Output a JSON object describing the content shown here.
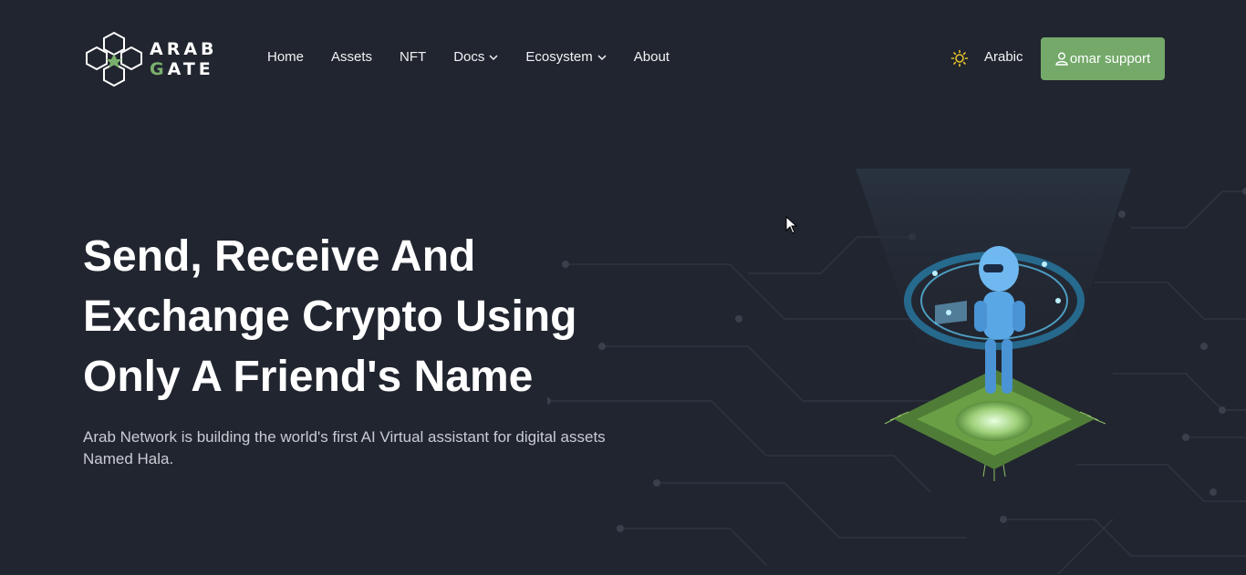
{
  "brand": {
    "line1": "ARAB",
    "line2_first": "G",
    "line2_rest": "ATE",
    "accent_color": "#7ab06d",
    "icon": "hexagon-cluster-logo-icon"
  },
  "nav": {
    "items": [
      {
        "label": "Home",
        "has_dropdown": false
      },
      {
        "label": "Assets",
        "has_dropdown": false
      },
      {
        "label": "NFT",
        "has_dropdown": false
      },
      {
        "label": "Docs",
        "has_dropdown": true
      },
      {
        "label": "Ecosystem",
        "has_dropdown": true
      },
      {
        "label": "About",
        "has_dropdown": false
      }
    ],
    "dropdown_icon": "chevron-down-icon"
  },
  "header_right": {
    "theme_icon": "sun-icon",
    "theme_icon_color": "#e6c229",
    "language_label": "Arabic",
    "support_button_label": "omar support",
    "support_button_icon": "user-icon",
    "support_button_color": "#74a96a"
  },
  "hero": {
    "title": "Send, Receive And Exchange Crypto Using Only A Friend's Name",
    "subtitle": "Arab Network is building the world's first AI Virtual assistant for digital assets Named Hala."
  },
  "colors": {
    "background": "#21252f",
    "text": "#ffffff",
    "subtext": "#c9ccd3"
  }
}
